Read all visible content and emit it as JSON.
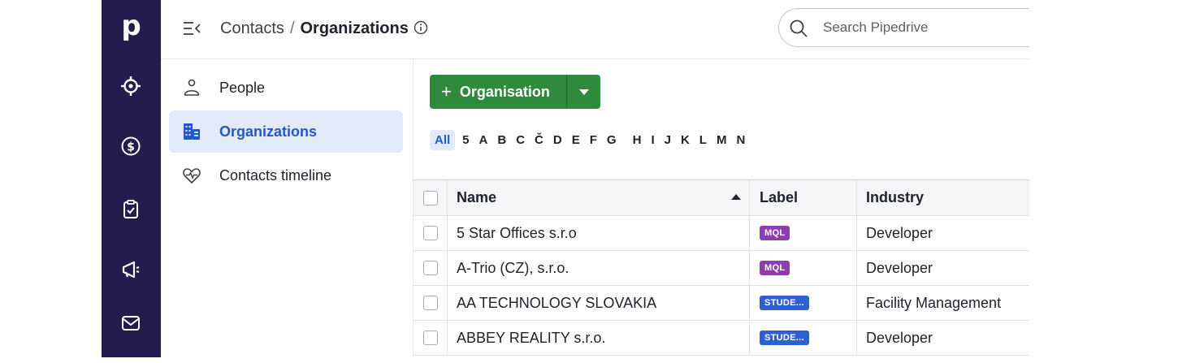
{
  "nav": {
    "logo": "p",
    "items": [
      {
        "icon": "target-icon"
      },
      {
        "icon": "dollar-icon"
      },
      {
        "icon": "clipboard-check-icon"
      },
      {
        "icon": "megaphone-icon"
      },
      {
        "icon": "mail-icon"
      }
    ]
  },
  "header": {
    "breadcrumb_parent": "Contacts",
    "separator": "/",
    "breadcrumb_current": "Organizations",
    "search_placeholder": "Search Pipedrive"
  },
  "sidebar": {
    "items": [
      {
        "label": "People",
        "icon": "person-icon",
        "active": false
      },
      {
        "label": "Organizations",
        "icon": "building-icon",
        "active": true
      },
      {
        "label": "Contacts timeline",
        "icon": "heart-pulse-icon",
        "active": false
      }
    ]
  },
  "toolbar": {
    "add_label": "Organisation",
    "add_plus": "+"
  },
  "alphabet": [
    "All",
    "5",
    "A",
    "B",
    "C",
    "Č",
    "D",
    "E",
    "F",
    "G",
    "H",
    "I",
    "J",
    "K",
    "L",
    "M",
    "N"
  ],
  "alphabet_selected": "All",
  "table": {
    "columns": [
      "Name",
      "Label",
      "Industry"
    ],
    "sort_column": "Name",
    "sort_direction": "ascending",
    "rows": [
      {
        "name": "5 Star Offices s.r.o",
        "label": "MQL",
        "label_color": "#8e3db0",
        "industry": "Developer"
      },
      {
        "name": "A-Trio (CZ), s.r.o.",
        "label": "MQL",
        "label_color": "#8e3db0",
        "industry": "Developer"
      },
      {
        "name": "AA TECHNOLOGY SLOVAKIA",
        "label": "STUDE...",
        "label_color": "#2f5fd1",
        "industry": "Facility Management"
      },
      {
        "name": "ABBEY REALITY s.r.o.",
        "label": "STUDE...",
        "label_color": "#2f5fd1",
        "industry": "Developer"
      }
    ]
  },
  "colors": {
    "rail": "#221c4f",
    "accent_blue": "#2159c8",
    "primary_green": "#2f8a3c"
  }
}
